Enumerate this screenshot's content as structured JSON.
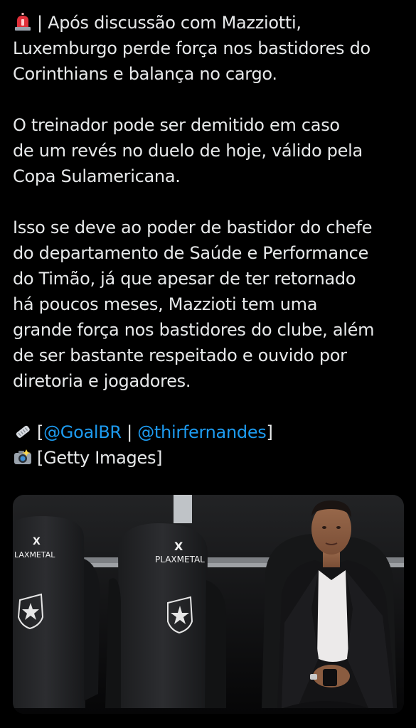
{
  "tweet": {
    "headline": [
      "| Após discussão com Mazziotti,",
      "Luxemburgo perde força nos bastidores do",
      "Corinthians e balança no cargo."
    ],
    "paragraph2": [
      "O treinador pode ser demitido em caso",
      "de um revés no duelo de hoje, válido pela",
      "Copa Sulamericana."
    ],
    "paragraph3": [
      "Isso se deve ao poder de bastidor do chefe",
      "do departamento de Saúde e Performance",
      "do Timão, já que apesar de ter retornado",
      "há poucos meses, Mazzioti tem uma",
      "grande força nos bastidores do clube, além",
      "de ser bastante respeitado e ouvido por",
      "diretoria e jogadores."
    ],
    "credits": {
      "open_bracket": "[",
      "mention1": "@GoalBR",
      "separator": " | ",
      "mention2": "@thirfernandes",
      "close_bracket": "]",
      "photo_credit": "[Getty Images]"
    },
    "icons": {
      "siren": "siren-icon",
      "newspaper": "newspaper-icon",
      "camera": "camera-icon"
    }
  },
  "media": {
    "sponsor_left": "LAXMETAL",
    "sponsor_center": "PLAXMETAL",
    "sponsor_logo": "X"
  },
  "colors": {
    "background": "#000000",
    "text": "#e7e9ea",
    "mention": "#1d9bf0"
  }
}
